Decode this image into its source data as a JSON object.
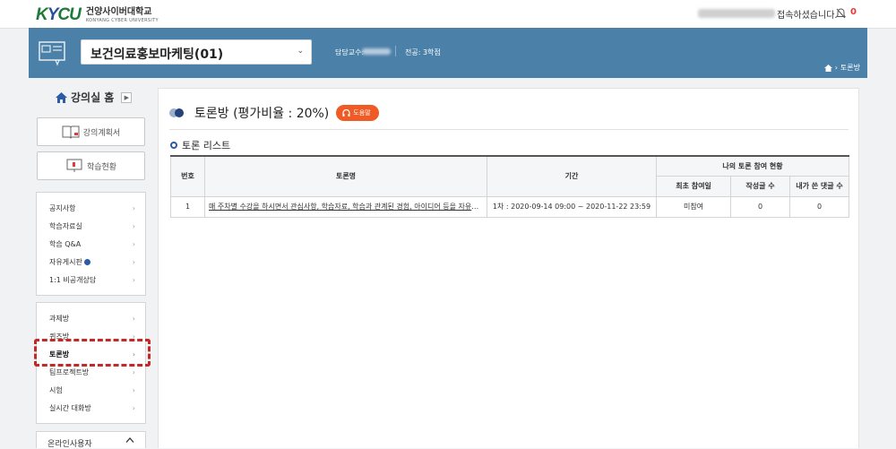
{
  "header": {
    "logo_mark": "KYCU",
    "logo_kr": "건양사이버대학교",
    "logo_en": "KONYANG CYBER UNIVERSITY",
    "connected_text": "접속하셨습니다.",
    "notification_count": "0"
  },
  "course": {
    "title": "보건의료홍보마케팅(01)",
    "professor_label": "담당교수:",
    "major": "전공: 3학점",
    "breadcrumb": "토론방"
  },
  "sidebar": {
    "home_label": "강의실 홈",
    "home_go": "▶",
    "buttons": [
      {
        "label": "강의계획서",
        "icon": "book-icon"
      },
      {
        "label": "학습현황",
        "icon": "presentation-icon"
      }
    ],
    "menu1": [
      {
        "label": "공지사항"
      },
      {
        "label": "학습자료실"
      },
      {
        "label": "학습 Q&A"
      },
      {
        "label": "자유게시판",
        "badge": true
      },
      {
        "label": "1:1 비공개상담"
      }
    ],
    "menu2": [
      {
        "label": "과제방"
      },
      {
        "label": "퀴즈방"
      },
      {
        "label": "토론방",
        "active": true
      },
      {
        "label": "팀프로젝트방"
      },
      {
        "label": "시험"
      },
      {
        "label": "실시간 대화방"
      }
    ],
    "arrow": "›",
    "online_label": "온라인사용자"
  },
  "main": {
    "title": "토론방 (평가비율 : 20%)",
    "help_label": "도움말",
    "section_title": "토론 리스트",
    "table": {
      "headers": {
        "no": "번호",
        "topic": "토론명",
        "period": "기간",
        "status_group": "나의 토론 참여 현황",
        "first_date": "최초 참여일",
        "post_count": "작성글 수",
        "comment_count": "내가 쓴 댓글 수"
      },
      "rows": [
        {
          "no": "1",
          "topic": "매 주차별 수강을 하시면서 관심사항, 학습자료, 학습과 관계된 경험, 아이디어 등을 자유롭게 나누어 보세요.",
          "period": "1차 : 2020-09-14 09:00 ~ 2020-11-22 23:59",
          "first_date": "미참여",
          "post_count": "0",
          "comment_count": "0"
        }
      ]
    }
  }
}
